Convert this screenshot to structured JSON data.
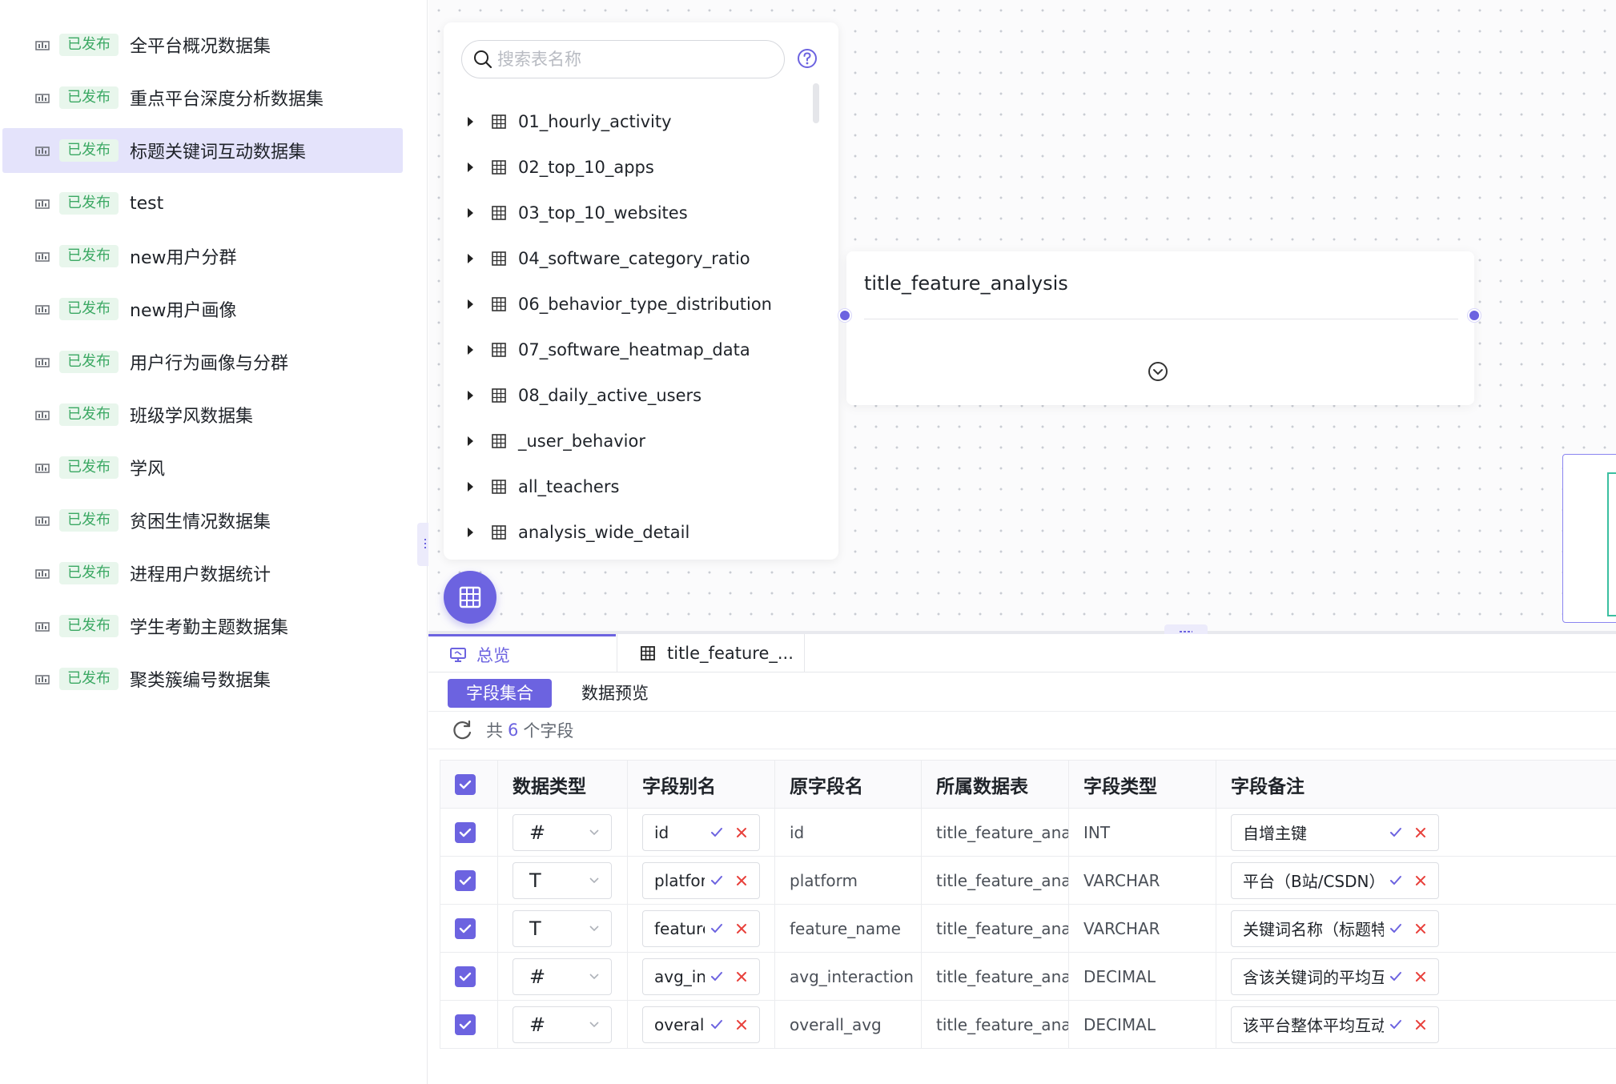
{
  "sidebar": {
    "items": [
      {
        "badge": "已发布",
        "name": "全平台概况数据集",
        "active": false
      },
      {
        "badge": "已发布",
        "name": "重点平台深度分析数据集",
        "active": false
      },
      {
        "badge": "已发布",
        "name": "标题关键词互动数据集",
        "active": true
      },
      {
        "badge": "已发布",
        "name": "test",
        "active": false
      },
      {
        "badge": "已发布",
        "name": "new用户分群",
        "active": false
      },
      {
        "badge": "已发布",
        "name": "new用户画像",
        "active": false
      },
      {
        "badge": "已发布",
        "name": "用户行为画像与分群",
        "active": false
      },
      {
        "badge": "已发布",
        "name": "班级学风数据集",
        "active": false
      },
      {
        "badge": "已发布",
        "name": "学风",
        "active": false
      },
      {
        "badge": "已发布",
        "name": "贫困生情况数据集",
        "active": false
      },
      {
        "badge": "已发布",
        "name": "进程用户数据统计",
        "active": false
      },
      {
        "badge": "已发布",
        "name": "学生考勤主题数据集",
        "active": false
      },
      {
        "badge": "已发布",
        "name": "聚类簇编号数据集",
        "active": false
      }
    ]
  },
  "tablelist": {
    "search_placeholder": "搜索表名称",
    "tables": [
      "01_hourly_activity",
      "02_top_10_apps",
      "03_top_10_websites",
      "04_software_category_ratio",
      "06_behavior_type_distribution",
      "07_software_heatmap_data",
      "08_daily_active_users",
      "_user_behavior",
      "all_teachers",
      "analysis_wide_detail"
    ]
  },
  "node": {
    "title": "title_feature_analysis"
  },
  "bottom": {
    "tabs": {
      "overview": "总览",
      "table": "title_feature_..."
    },
    "subtabs": {
      "fields": "字段集合",
      "preview": "数据预览"
    },
    "info": {
      "prefix": "共",
      "count": "6",
      "suffix": "个字段"
    },
    "columns": [
      "数据类型",
      "字段别名",
      "原字段名",
      "所属数据表",
      "字段类型",
      "字段备注"
    ],
    "rows": [
      {
        "type_icon": "#",
        "alias": "id",
        "original": "id",
        "table": "title_feature_analysis",
        "field_type": "INT",
        "remark": "自增主键"
      },
      {
        "type_icon": "T",
        "alias": "platform",
        "original": "platform",
        "table": "title_feature_analysis",
        "field_type": "VARCHAR",
        "remark": "平台（B站/CSDN）"
      },
      {
        "type_icon": "T",
        "alias": "feature_nar",
        "original": "feature_name",
        "table": "title_feature_analysis",
        "field_type": "VARCHAR",
        "remark": "关键词名称（标题特"
      },
      {
        "type_icon": "#",
        "alias": "avg_interac",
        "original": "avg_interaction",
        "table": "title_feature_analysis",
        "field_type": "DECIMAL",
        "remark": "含该关键词的平均互"
      },
      {
        "type_icon": "#",
        "alias": "overall_avg",
        "original": "overall_avg",
        "table": "title_feature_analysis",
        "field_type": "DECIMAL",
        "remark": "该平台整体平均互动"
      }
    ]
  },
  "colors": {
    "accent": "#6c63e0",
    "badge_green": "#3ba863",
    "badge_bg": "#e8f6ec",
    "cancel_red": "#e8413c",
    "active_row": "#e4e3fb"
  }
}
